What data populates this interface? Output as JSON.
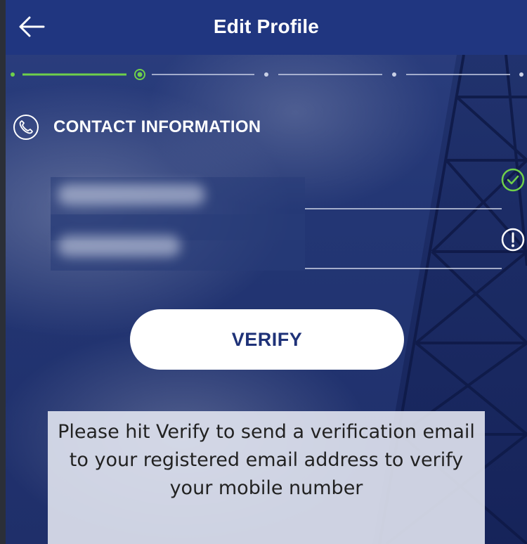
{
  "header": {
    "title": "Edit Profile",
    "back_icon": "arrow-left-icon"
  },
  "stepper": {
    "steps": 4,
    "current_step": 2,
    "active_color": "#6fd04a",
    "inactive_color": "#c9d0e6"
  },
  "section": {
    "icon": "phone-icon",
    "title": "CONTACT INFORMATION"
  },
  "fields": [
    {
      "name": "email",
      "status_icon": "check-circle-icon",
      "status_color": "#6fd04a"
    },
    {
      "name": "mobile",
      "status_icon": "alert-circle-icon",
      "status_color": "#ffffff"
    }
  ],
  "verify": {
    "label": "VERIFY"
  },
  "info_message": "Please hit Verify to send a verification email to your registered email address to verify your mobile number",
  "colors": {
    "header_bg": "#203680",
    "button_text": "#1f3278",
    "info_bg": "#e1e4f0"
  }
}
